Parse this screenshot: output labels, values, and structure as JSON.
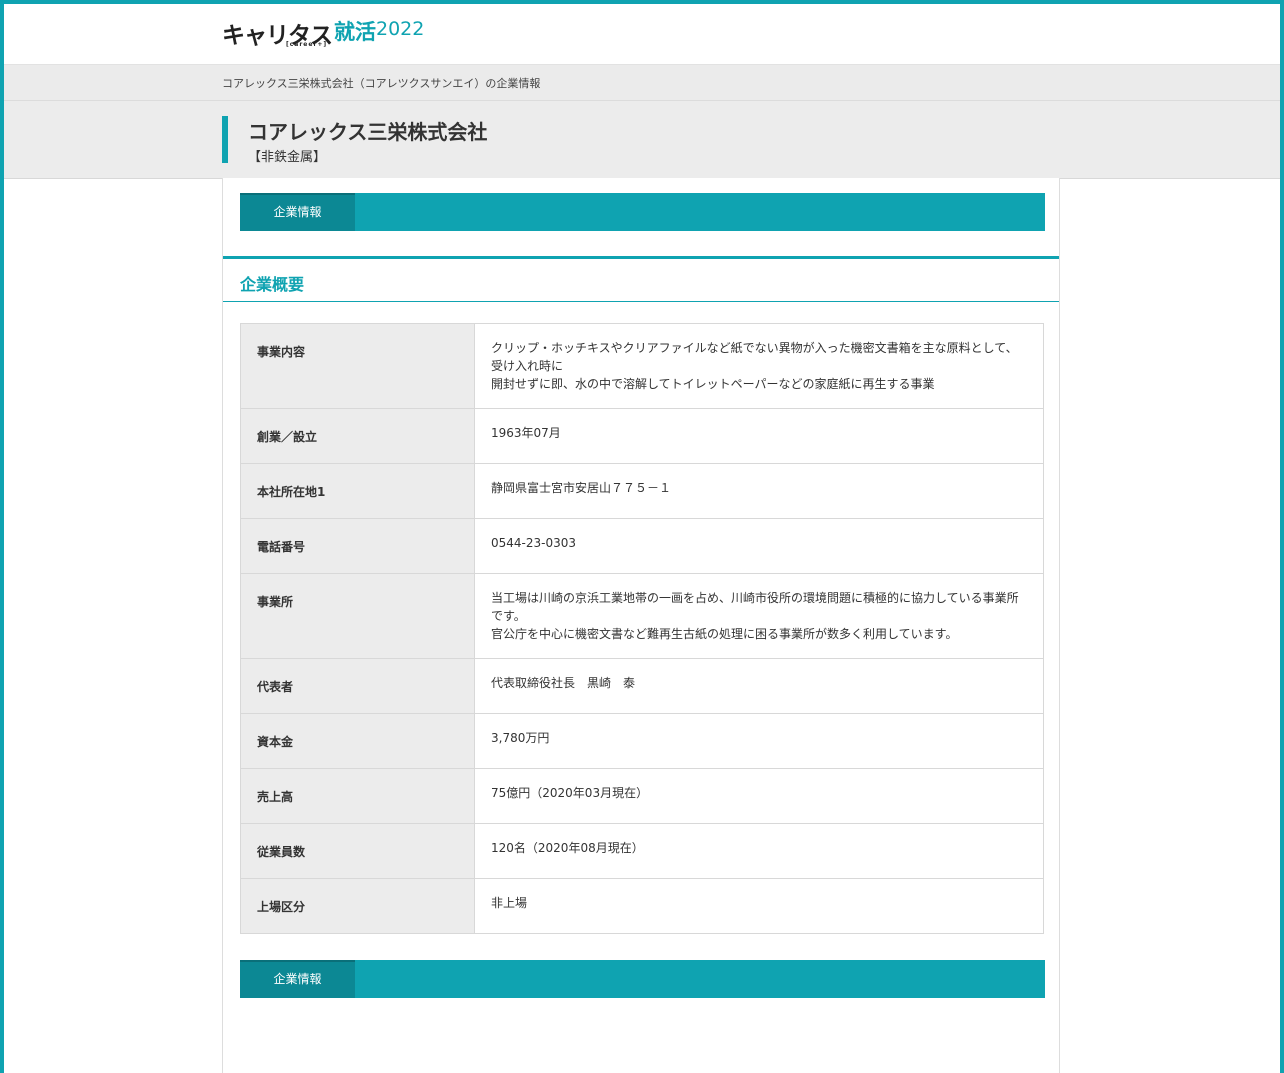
{
  "header": {
    "logo_main": "キャリタス",
    "logo_sub": "[career+]",
    "logo_accent": "就活",
    "logo_year": "2022"
  },
  "breadcrumb": {
    "text": "コアレックス三栄株式会社（コアレツクスサンエイ）の企業情報"
  },
  "company": {
    "name": "コアレックス三栄株式会社",
    "industry": "【非鉄金属】"
  },
  "tabs": {
    "top_label": "企業情報",
    "bottom_label": "企業情報"
  },
  "section": {
    "title": "企業概要"
  },
  "overview": [
    {
      "label": "事業内容",
      "lines": [
        "クリップ・ホッチキスやクリアファイルなど紙でない異物が入った機密文書箱を主な原料として、",
        "受け入れ時に",
        "開封せずに即、水の中で溶解してトイレットペーパーなどの家庭紙に再生する事業"
      ]
    },
    {
      "label": "創業／設立",
      "lines": [
        "1963年07月"
      ]
    },
    {
      "label": "本社所在地1",
      "lines": [
        "静岡県富士宮市安居山７７５－１"
      ]
    },
    {
      "label": "電話番号",
      "lines": [
        "0544-23-0303"
      ]
    },
    {
      "label": "事業所",
      "lines": [
        "当工場は川崎の京浜工業地帯の一画を占め、川崎市役所の環境問題に積極的に協力している事業所",
        "です。",
        "官公庁を中心に機密文書など難再生古紙の処理に困る事業所が数多く利用しています。"
      ]
    },
    {
      "label": "代表者",
      "lines": [
        "代表取締役社長　黒崎　泰"
      ]
    },
    {
      "label": "資本金",
      "lines": [
        "3,780万円"
      ]
    },
    {
      "label": "売上高",
      "lines": [
        "75億円（2020年03月現在）"
      ]
    },
    {
      "label": "従業員数",
      "lines": [
        "120名（2020年08月現在）"
      ]
    },
    {
      "label": "上場区分",
      "lines": [
        "非上場"
      ]
    }
  ]
}
